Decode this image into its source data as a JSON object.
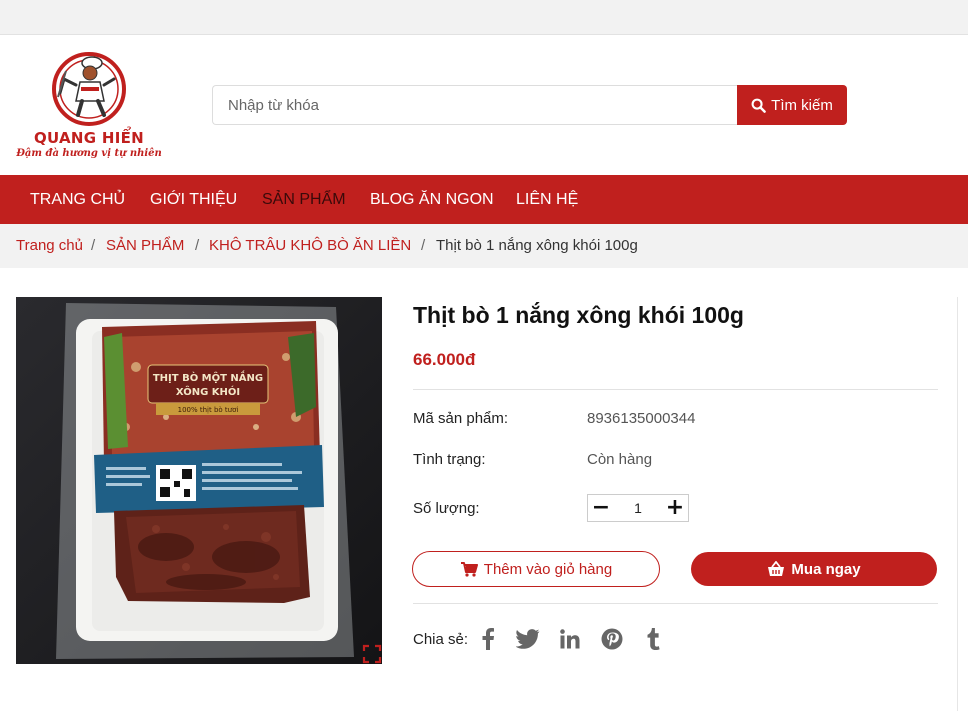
{
  "brand": {
    "name": "QUANG HIỂN",
    "tagline": "Đậm đà hương vị tự nhiên"
  },
  "search": {
    "placeholder": "Nhập từ khóa",
    "button_label": "Tìm kiếm"
  },
  "nav": {
    "items": [
      {
        "label": "TRANG CHỦ"
      },
      {
        "label": "GIỚI THIỆU"
      },
      {
        "label": "SẢN PHẨM",
        "active": true
      },
      {
        "label": "BLOG ĂN NGON"
      },
      {
        "label": "LIÊN HỆ"
      }
    ]
  },
  "breadcrumb": {
    "items": [
      "Trang chủ",
      "SẢN PHẨM",
      "KHÔ TRÂU KHÔ BÒ ĂN LIỀN"
    ],
    "separator": "/",
    "current": "Thịt bò 1 nắng xông khói 100g"
  },
  "product": {
    "title": "Thịt bò 1 nắng xông khói 100g",
    "price": "66.000đ",
    "sku_label": "Mã sản phẩm:",
    "sku": "8936135000344",
    "status_label": "Tình trạng:",
    "status": "Còn hàng",
    "qty_label": "Số lượng:",
    "qty": "1",
    "add_to_cart": "Thêm vào giỏ hàng",
    "buy_now": "Mua ngay"
  },
  "package": {
    "label_line1": "THỊT BÒ MỘT NẮNG",
    "label_line2": "XÔNG KHÓI",
    "sub": "100% thịt bò tươi"
  },
  "share": {
    "label": "Chia sẻ:",
    "icons": [
      "facebook-icon",
      "twitter-icon",
      "linkedin-icon",
      "pinterest-icon",
      "tumblr-icon"
    ]
  },
  "colors": {
    "brand_red": "#c0201e",
    "nav_active": "#3a0a0a",
    "icon_gray": "#666666"
  }
}
